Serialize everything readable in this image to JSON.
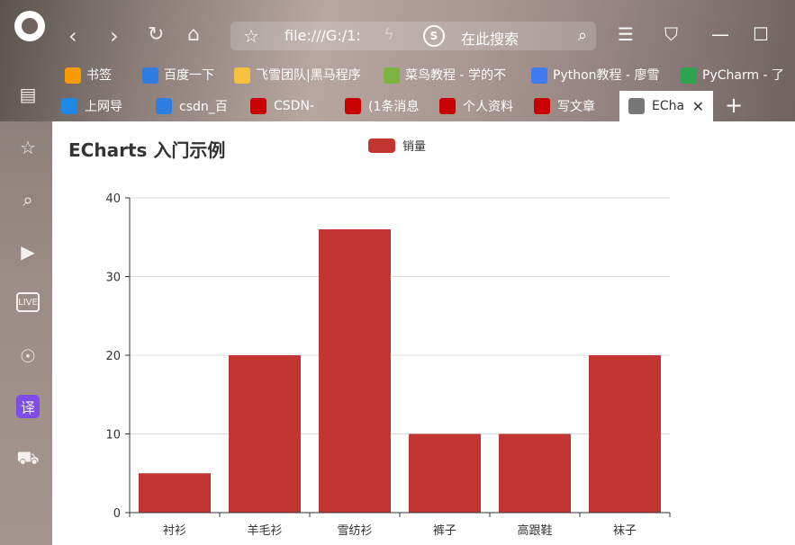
{
  "browser": {
    "address_url": "file:///G:/1:",
    "search_placeholder": "在此搜索",
    "bookmarks": [
      {
        "label": "书签",
        "icon": "star-icon",
        "color": "#f59a00"
      },
      {
        "label": "百度一下",
        "icon": "baidu-2345-icon",
        "color": "#2f7de1"
      },
      {
        "label": "飞雪团队|黑马程序",
        "icon": "folder-icon",
        "color": "#f6c23e"
      },
      {
        "label": "菜鸟教程 - 学的不",
        "icon": "runoob-icon",
        "color": "#7cb342"
      },
      {
        "label": "Python教程 - 廖雪",
        "icon": "rocket-icon",
        "color": "#3f7cf2"
      },
      {
        "label": "PyCharm - 了",
        "icon": "pycharm-icon",
        "color": "#2ea44f"
      }
    ],
    "tabs": [
      {
        "label": "上网导",
        "icon": "ie-icon",
        "color": "#1e88e5"
      },
      {
        "label": "csdn_百",
        "icon": "baidu-paw-icon",
        "color": "#2f7de1"
      },
      {
        "label": "CSDN-",
        "icon": "csdn-icon",
        "color": "#c90000"
      },
      {
        "label": "(1条消息",
        "icon": "csdn-icon",
        "color": "#c90000"
      },
      {
        "label": "个人资料",
        "icon": "csdn-icon",
        "color": "#c90000"
      },
      {
        "label": "写文章",
        "icon": "csdn-icon",
        "color": "#c90000"
      },
      {
        "label": "ECha",
        "icon": "globe-icon",
        "color": "#777777"
      }
    ]
  },
  "chart_data": {
    "type": "bar",
    "title": "ECharts 入门示例",
    "categories": [
      "衬衫",
      "羊毛衫",
      "雪纺衫",
      "裤子",
      "高跟鞋",
      "袜子"
    ],
    "series": [
      {
        "name": "销量",
        "values": [
          5,
          20,
          36,
          10,
          10,
          20
        ],
        "color": "#c23531"
      }
    ],
    "ylim": [
      0,
      40
    ],
    "yticks": [
      0,
      10,
      20,
      30,
      40
    ],
    "grid": true,
    "legend": "top-center"
  }
}
